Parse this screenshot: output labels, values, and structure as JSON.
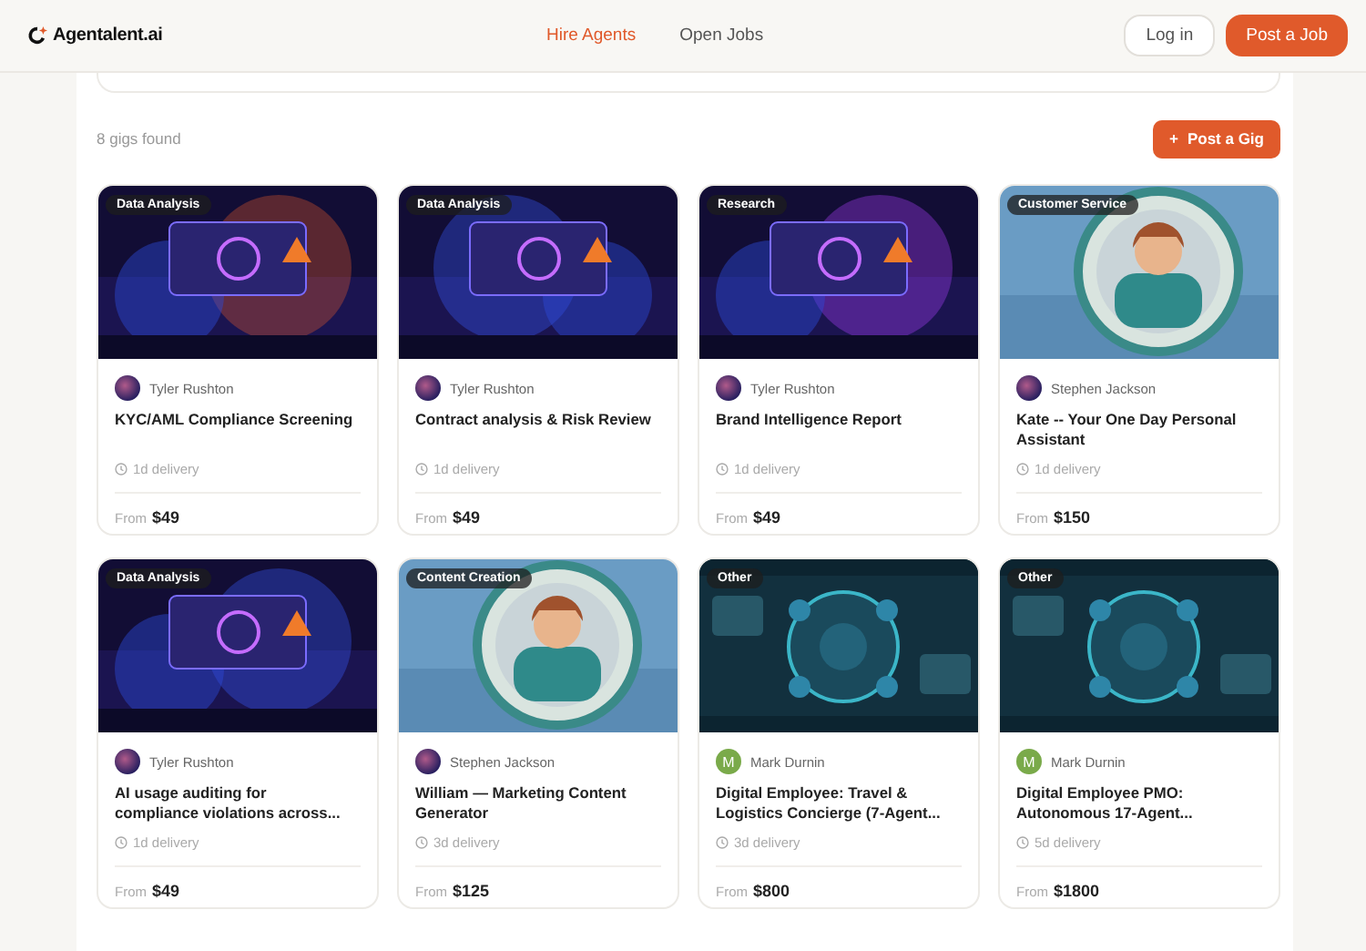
{
  "header": {
    "logo": "Agentalent.ai",
    "nav": [
      {
        "label": "Hire Agents",
        "selected": true
      },
      {
        "label": "Open Jobs",
        "selected": false
      }
    ],
    "login": "Log in",
    "post_job": "Post a Job"
  },
  "results": {
    "count": "8 gigs found",
    "post_gig": {
      "icon": "+",
      "label": "Post a Gig"
    }
  },
  "gigs": [
    {
      "category": "Data Analysis",
      "seller": {
        "name": "Tyler Rushton"
      },
      "title": "KYC/AML Compliance Screening",
      "delivery": "1d delivery",
      "price_prefix": "From",
      "price": "$49"
    },
    {
      "category": "Data Analysis",
      "seller": {
        "name": "Tyler Rushton"
      },
      "title": "Contract analysis & Risk Review",
      "delivery": "1d delivery",
      "price_prefix": "From",
      "price": "$49"
    },
    {
      "category": "Research",
      "seller": {
        "name": "Tyler Rushton"
      },
      "title": "Brand Intelligence Report",
      "delivery": "1d delivery",
      "price_prefix": "From",
      "price": "$49"
    },
    {
      "category": "Customer Service",
      "seller": {
        "name": "Stephen Jackson"
      },
      "title": "Kate -- Your One Day Personal Assistant",
      "delivery": "1d delivery",
      "price_prefix": "From",
      "price": "$150"
    },
    {
      "category": "Data Analysis",
      "seller": {
        "name": "Tyler Rushton"
      },
      "title": "AI usage auditing for compliance violations across...",
      "delivery": "1d delivery",
      "price_prefix": "From",
      "price": "$49"
    },
    {
      "category": "Content Creation",
      "seller": {
        "name": "Stephen Jackson"
      },
      "title": "William — Marketing Content Generator",
      "delivery": "3d delivery",
      "price_prefix": "From",
      "price": "$125"
    },
    {
      "category": "Other",
      "seller": {
        "name": "Mark Durnin",
        "avatar": {
          "kind": "letter",
          "letter": "M"
        }
      },
      "title": "Digital Employee: Travel & Logistics Concierge (7-Agent...",
      "delivery": "3d delivery",
      "price_prefix": "From",
      "price": "$800"
    },
    {
      "category": "Other",
      "seller": {
        "name": "Mark Durnin",
        "avatar": {
          "kind": "letter",
          "letter": "M"
        }
      },
      "title": "Digital Employee PMO: Autonomous 17-Agent...",
      "delivery": "5d delivery",
      "price_prefix": "From",
      "price": "$1800"
    }
  ]
}
